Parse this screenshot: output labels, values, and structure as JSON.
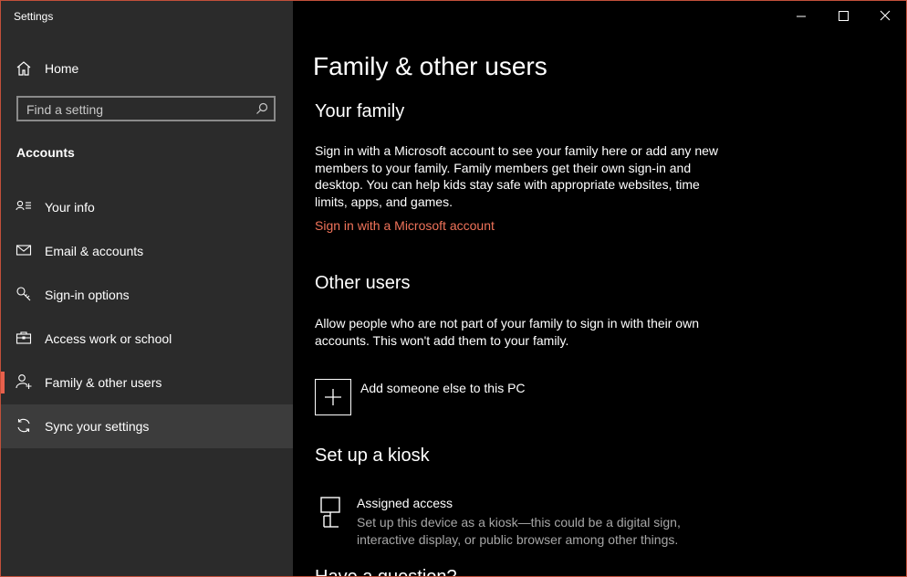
{
  "app": {
    "title": "Settings"
  },
  "sidebar": {
    "home_label": "Home",
    "search_placeholder": "Find a setting",
    "section": "Accounts",
    "items": [
      {
        "label": "Your info",
        "icon": "person-card-icon"
      },
      {
        "label": "Email & accounts",
        "icon": "mail-icon"
      },
      {
        "label": "Sign-in options",
        "icon": "key-icon"
      },
      {
        "label": "Access work or school",
        "icon": "briefcase-icon"
      },
      {
        "label": "Family & other users",
        "icon": "add-person-icon",
        "active": true
      },
      {
        "label": "Sync your settings",
        "icon": "sync-icon",
        "hover": true
      }
    ]
  },
  "main": {
    "title": "Family & other users",
    "family": {
      "heading": "Your family",
      "text": "Sign in with a Microsoft account to see your family here or add any new members to your family. Family members get their own sign-in and desktop. You can help kids stay safe with appropriate websites, time limits, apps, and games.",
      "link": "Sign in with a Microsoft account"
    },
    "other": {
      "heading": "Other users",
      "text": "Allow people who are not part of your family to sign in with their own accounts. This won't add them to your family.",
      "add_label": "Add someone else to this PC"
    },
    "kiosk": {
      "heading": "Set up a kiosk",
      "title": "Assigned access",
      "desc": "Set up this device as a kiosk—this could be a digital sign, interactive display, or public browser among other things."
    },
    "cutoff_heading": "Have a question?"
  },
  "colors": {
    "accent": "#e8604c",
    "link": "#f0735a",
    "sidebar_bg": "#2b2b2b",
    "hover_bg": "#3c3c3c"
  }
}
